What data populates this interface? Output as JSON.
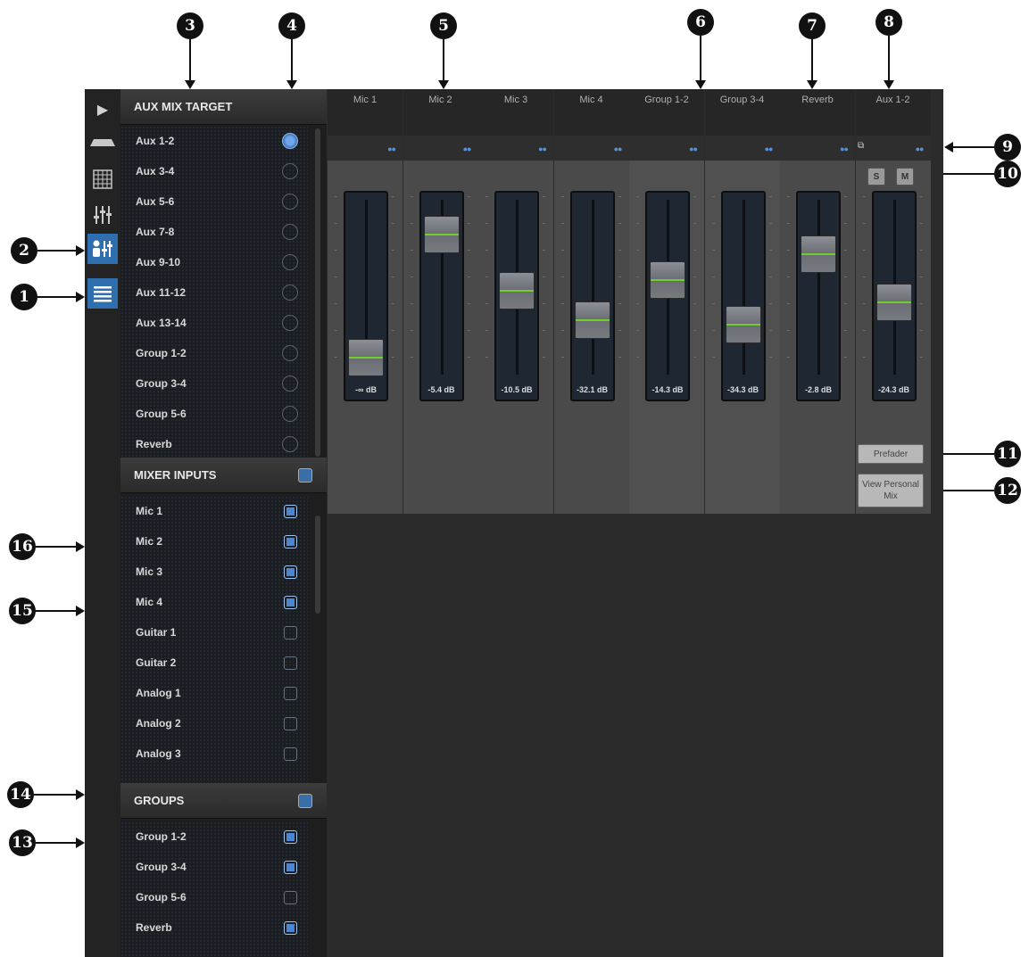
{
  "callouts": [
    "1",
    "2",
    "3",
    "4",
    "5",
    "6",
    "7",
    "8",
    "9",
    "10",
    "11",
    "12",
    "13",
    "14",
    "15",
    "16"
  ],
  "aux_target": {
    "title": "AUX MIX TARGET",
    "items": [
      {
        "label": "Aux 1-2",
        "selected": true
      },
      {
        "label": "Aux 3-4",
        "selected": false
      },
      {
        "label": "Aux 5-6",
        "selected": false
      },
      {
        "label": "Aux 7-8",
        "selected": false
      },
      {
        "label": "Aux 9-10",
        "selected": false
      },
      {
        "label": "Aux 11-12",
        "selected": false
      },
      {
        "label": "Aux 13-14",
        "selected": false
      },
      {
        "label": "Group 1-2",
        "selected": false
      },
      {
        "label": "Group 3-4",
        "selected": false
      },
      {
        "label": "Group 5-6",
        "selected": false
      },
      {
        "label": "Reverb",
        "selected": false
      }
    ]
  },
  "mixer_inputs": {
    "title": "MIXER INPUTS",
    "items": [
      {
        "label": "Mic 1",
        "checked": true
      },
      {
        "label": "Mic 2",
        "checked": true
      },
      {
        "label": "Mic 3",
        "checked": true
      },
      {
        "label": "Mic 4",
        "checked": true
      },
      {
        "label": "Guitar 1",
        "checked": false
      },
      {
        "label": "Guitar 2",
        "checked": false
      },
      {
        "label": "Analog 1",
        "checked": false
      },
      {
        "label": "Analog 2",
        "checked": false
      },
      {
        "label": "Analog 3",
        "checked": false
      }
    ]
  },
  "groups": {
    "title": "GROUPS",
    "items": [
      {
        "label": "Group 1-2",
        "checked": true
      },
      {
        "label": "Group 3-4",
        "checked": true
      },
      {
        "label": "Group 5-6",
        "checked": false
      },
      {
        "label": "Reverb",
        "checked": true
      }
    ]
  },
  "channels": [
    {
      "name": "Mic 1",
      "db": "-∞ dB",
      "level": 0.05
    },
    {
      "name": "Mic 2",
      "db": "-5.4 dB",
      "level": 0.88
    },
    {
      "name": "Mic 3",
      "db": "-10.5 dB",
      "level": 0.5
    },
    {
      "name": "Mic 4",
      "db": "-32.1 dB",
      "level": 0.3
    },
    {
      "name": "Group 1-2",
      "db": "-14.3 dB",
      "level": 0.57
    },
    {
      "name": "Group 3-4",
      "db": "-34.3 dB",
      "level": 0.27
    },
    {
      "name": "Reverb",
      "db": "-2.8 dB",
      "level": 0.75
    },
    {
      "name": "Aux 1-2",
      "db": "-24.3 dB",
      "level": 0.42
    }
  ],
  "master_controls": {
    "solo": "S",
    "mute": "M",
    "prefader": "Prefader",
    "view_personal_mix": "View Personal Mix"
  },
  "colors": {
    "accent": "#4a86d4",
    "fader_line": "#6fd02c"
  }
}
